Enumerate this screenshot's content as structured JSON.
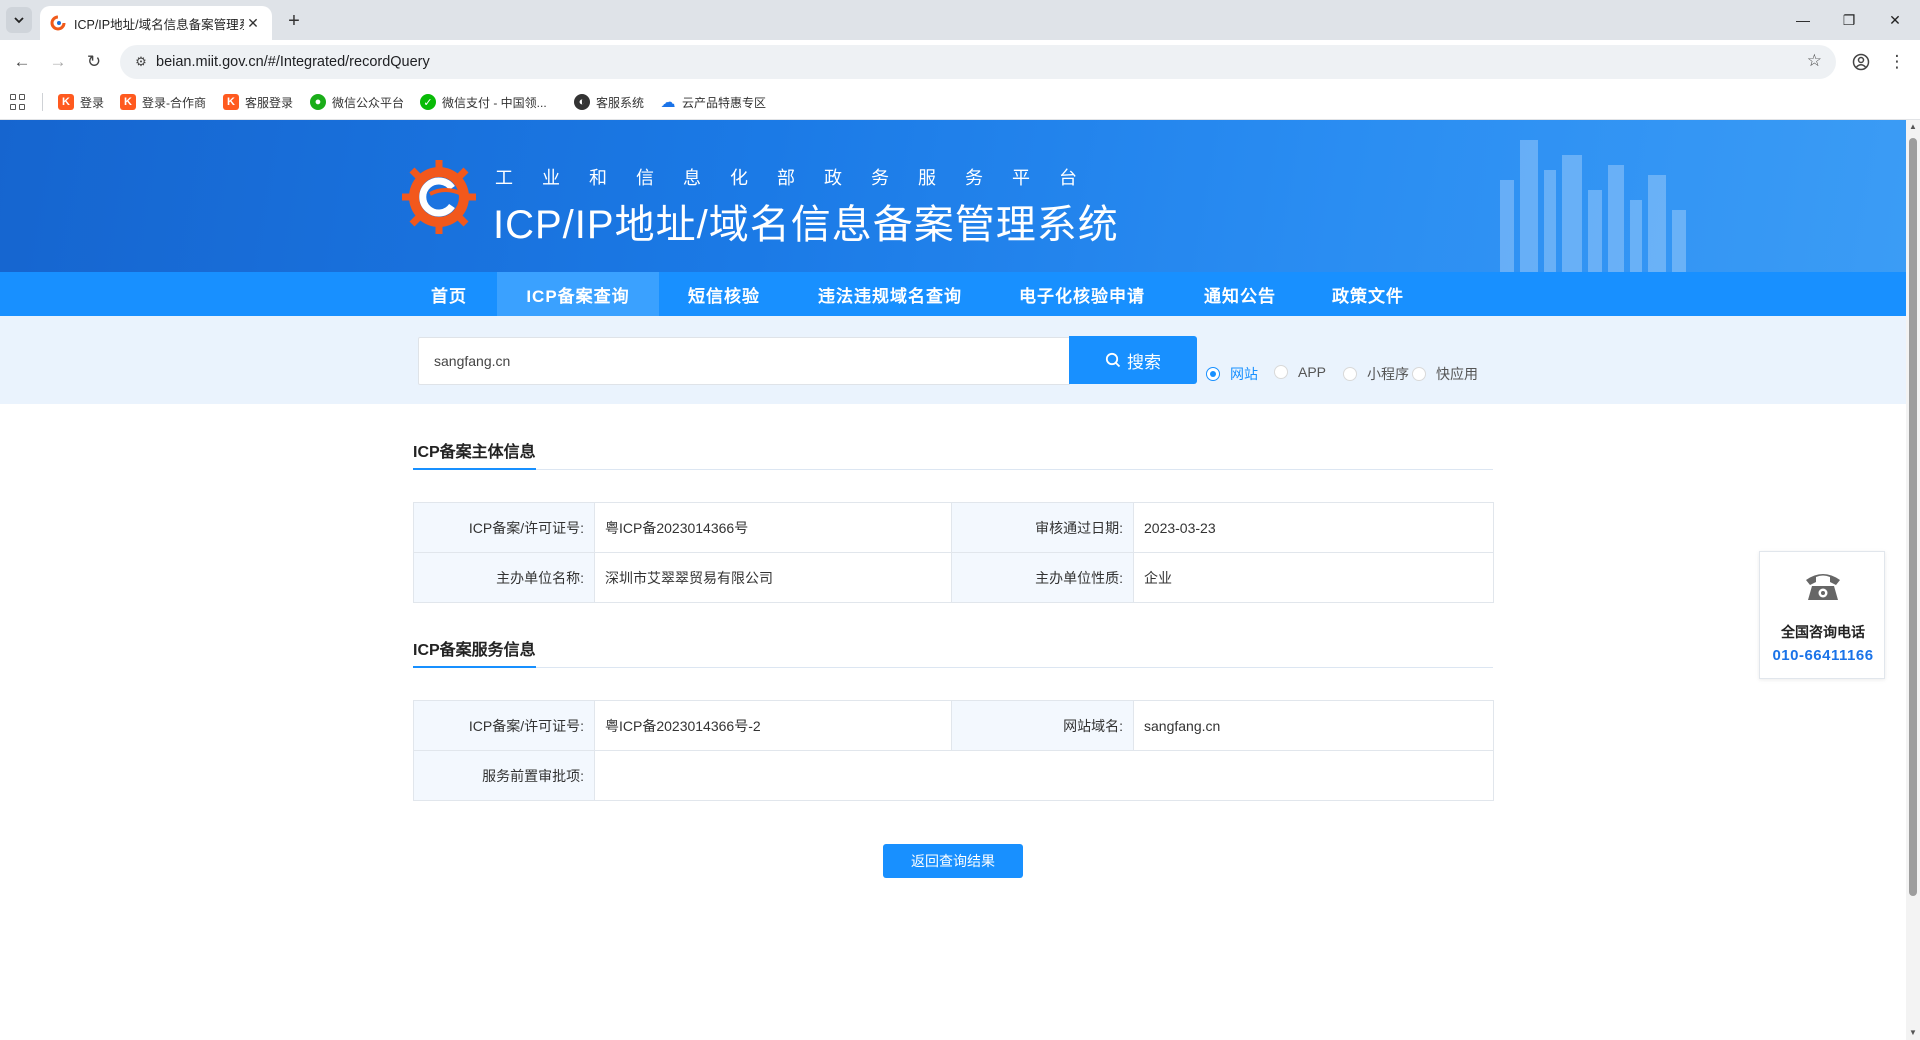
{
  "browser": {
    "tab_title": "ICP/IP地址/域名信息备案管理系统",
    "url": "beian.miit.gov.cn/#/Integrated/recordQuery",
    "bookmarks": [
      {
        "label": "登录",
        "icon": "k-logo-icon"
      },
      {
        "label": "登录-合作商",
        "icon": "k-logo-icon"
      },
      {
        "label": "客服登录",
        "icon": "k-logo-icon"
      },
      {
        "label": "微信公众平台",
        "icon": "wechat-icon"
      },
      {
        "label": "微信支付 - 中国领...",
        "icon": "wechat-pay-icon"
      },
      {
        "label": "客服系统",
        "icon": "service-icon"
      },
      {
        "label": "云产品特惠专区",
        "icon": "cloud-icon"
      }
    ]
  },
  "header": {
    "subtitle": "工业和信息化部政务服务平台",
    "title": "ICP/IP地址/域名信息备案管理系统"
  },
  "nav": {
    "items": [
      "首页",
      "ICP备案查询",
      "短信核验",
      "违法违规域名查询",
      "电子化核验申请",
      "通知公告",
      "政策文件"
    ],
    "active_index": 1
  },
  "search": {
    "value": "sangfang.cn",
    "button_label": "搜索",
    "options": [
      "网站",
      "APP",
      "小程序",
      "快应用"
    ],
    "selected": "网站"
  },
  "subject_info": {
    "title": "ICP备案主体信息",
    "rows": [
      {
        "label1": "ICP备案/许可证号:",
        "value1": "粤ICP备2023014366号",
        "label2": "审核通过日期:",
        "value2": "2023-03-23"
      },
      {
        "label1": "主办单位名称:",
        "value1": "深圳市艾翠翠贸易有限公司",
        "label2": "主办单位性质:",
        "value2": "企业"
      }
    ]
  },
  "service_info": {
    "title": "ICP备案服务信息",
    "rows": [
      {
        "label1": "ICP备案/许可证号:",
        "value1": "粤ICP备2023014366号-2",
        "label2": "网站域名:",
        "value2": "sangfang.cn"
      },
      {
        "label1": "服务前置审批项:",
        "value1": ""
      }
    ]
  },
  "back_button_label": "返回查询结果",
  "hotline": {
    "label": "全国咨询电话",
    "number": "010-66411166"
  },
  "colors": {
    "primary": "#1890ff",
    "banner_dark": "#1665cf",
    "table_label_bg": "#f3f8fe",
    "search_band_bg": "#eaf3fd"
  }
}
